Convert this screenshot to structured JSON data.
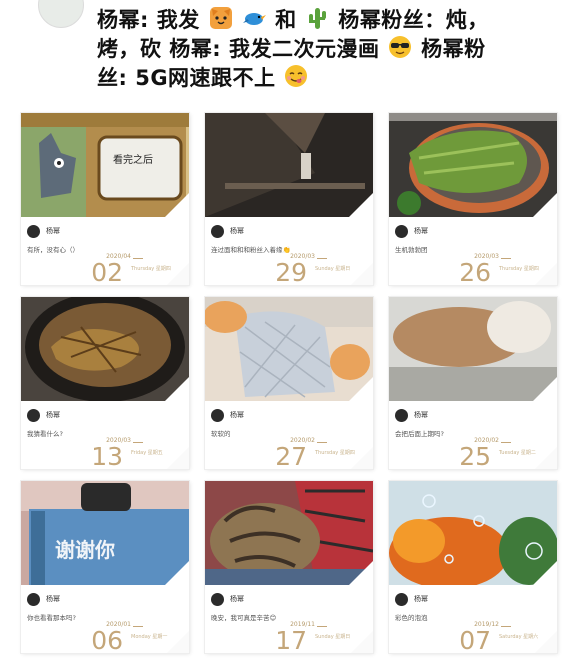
{
  "post": {
    "line1_a": "杨幂: 我发",
    "line1_b": "和",
    "line1_c": "杨幂粉丝：炖，",
    "line2": "烤，砍 杨幂: 我发二次元漫画",
    "line2_b": " 杨幂粉",
    "line3": "丝: 5G网速跟不上",
    "emojis": [
      "cat-face-emoji",
      "bird-emoji",
      "cactus-emoji",
      "sunglasses-emoji",
      "savoring-food-emoji"
    ]
  },
  "cards": [
    {
      "author": "杨幂",
      "caption": "有所，没有心（）",
      "ym": "2020/04",
      "day": "02",
      "week": "Thursday 星期四",
      "photo": "cartoon-tv-scene"
    },
    {
      "author": "杨幂",
      "caption": "连过面和和和粉丝入着缘👏",
      "ym": "2020/03",
      "day": "29",
      "week": "Sunday 星期日",
      "photo": "dark-room-corner"
    },
    {
      "author": "杨幂",
      "caption": "生机勃勃团",
      "ym": "2020/03",
      "day": "26",
      "week": "Thursday 星期四",
      "photo": "potted-cactus"
    },
    {
      "author": "杨幂",
      "caption": "我猜看什么?",
      "ym": "2020/03",
      "day": "13",
      "week": "Friday 星期五",
      "photo": "pot-stew"
    },
    {
      "author": "杨幂",
      "caption": "软软的",
      "ym": "2020/02",
      "day": "27",
      "week": "Thursday 星期四",
      "photo": "baking-mitt"
    },
    {
      "author": "杨幂",
      "caption": "会把后面上期吗?",
      "ym": "2020/02",
      "day": "25",
      "week": "Tuesday 星期二",
      "photo": "sleeping-cat"
    },
    {
      "author": "杨幂",
      "caption": "你也看看那本吗?",
      "ym": "2020/01",
      "day": "06",
      "week": "Monday 星期一",
      "photo": "blue-book"
    },
    {
      "author": "杨幂",
      "caption": "晚安，我可真是辛苦😊",
      "ym": "2019/11",
      "day": "17",
      "week": "Sunday 星期日",
      "photo": "tabby-cat-blanket"
    },
    {
      "author": "杨幂",
      "caption": "彩色的泡泡",
      "ym": "2019/12",
      "day": "07",
      "week": "Saturday 星期六",
      "photo": "autumn-bubbles"
    }
  ]
}
